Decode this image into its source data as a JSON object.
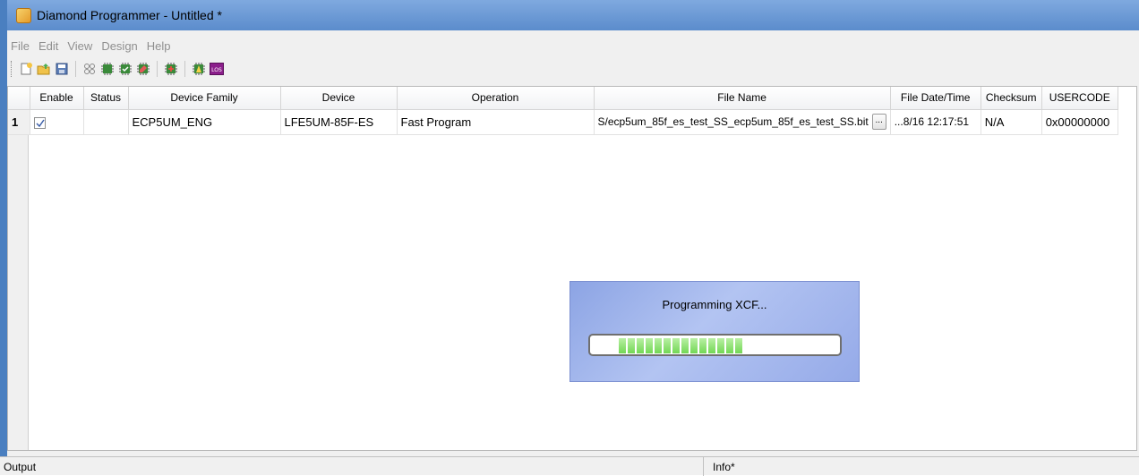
{
  "window": {
    "title": "Diamond Programmer - Untitled *"
  },
  "menu": [
    "File",
    "Edit",
    "View",
    "Design",
    "Help"
  ],
  "toolbar": {
    "icons": [
      "new-project-icon",
      "open-project-icon",
      "save-icon",
      "scan-icon",
      "program-icon",
      "verify-icon",
      "erase-icon",
      "cable-settings-icon",
      "advanced-icon",
      "los-icon"
    ],
    "los_label": "LOS"
  },
  "table": {
    "columns": [
      "",
      "Enable",
      "Status",
      "Device Family",
      "Device",
      "Operation",
      "File Name",
      "File Date/Time",
      "Checksum",
      "USERCODE"
    ],
    "rows": [
      {
        "num": "1",
        "enabled": true,
        "status": "",
        "family": "ECP5UM_ENG",
        "device": "LFE5UM-85F-ES",
        "operation": "Fast Program",
        "file_name": "S/ecp5um_85f_es_test_SS_ecp5um_85f_es_test_SS.bit",
        "browse_label": "...",
        "file_datetime": "...8/16 12:17:51",
        "checksum": "N/A",
        "usercode": "0x00000000"
      }
    ]
  },
  "progress": {
    "label": "Programming XCF...",
    "fraction": 0.5
  },
  "status_bar": {
    "left": "Output",
    "right": "Info*"
  },
  "colors": {
    "titlebar": "#6b98d4",
    "progress_fill": "#86dd6a",
    "dialog_bg": "#a3b6ee"
  }
}
